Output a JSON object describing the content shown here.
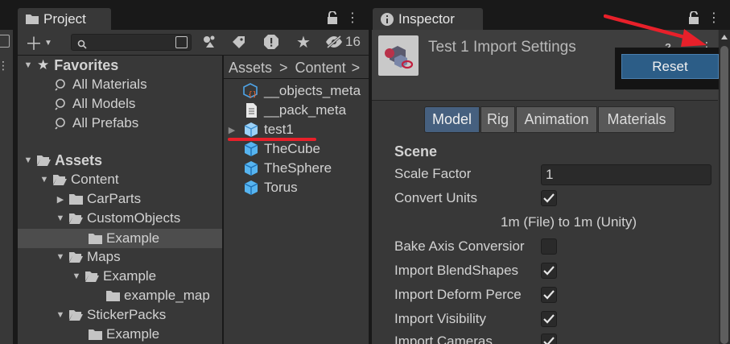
{
  "project_tab": {
    "title": "Project"
  },
  "inspector_tab": {
    "title": "Inspector"
  },
  "toolbar": {
    "hidden_count": "16",
    "search_value": ""
  },
  "favorites": {
    "label": "Favorites",
    "items": [
      "All Materials",
      "All Models",
      "All Prefabs"
    ]
  },
  "tree": {
    "assets": "Assets",
    "content": "Content",
    "carparts": "CarParts",
    "customobjects": "CustomObjects",
    "example1": "Example",
    "maps": "Maps",
    "example2": "Example",
    "example_map": "example_map",
    "stickerpacks": "StickerPacks",
    "example3": "Example"
  },
  "breadcrumb": {
    "root": "Assets",
    "sep": ">",
    "current": "Content",
    "sep2": ">"
  },
  "files": [
    "__objects_meta",
    "__pack_meta",
    "test1",
    "TheCube",
    "TheSphere",
    "Torus"
  ],
  "inspector": {
    "title": "Test 1 Import Settings",
    "context_menu_reset": "Reset",
    "tabs": [
      "Model",
      "Rig",
      "Animation",
      "Materials"
    ],
    "section": "Scene",
    "scale_factor_label": "Scale Factor",
    "scale_factor_value": "1",
    "convert_units_label": "Convert Units",
    "convert_note": "1m (File) to 1m (Unity)",
    "bake_axis_label": "Bake Axis Conversior",
    "blendshapes_label": "Import BlendShapes",
    "deform_label": "Import Deform Perce",
    "visibility_label": "Import Visibility",
    "cameras_label": "Import Cameras"
  },
  "colors": {
    "accent_blue": "#3d6391",
    "selection": "#4d4d4d",
    "annotation_red": "#e8202a",
    "reset_bg": "#2c5d87"
  }
}
